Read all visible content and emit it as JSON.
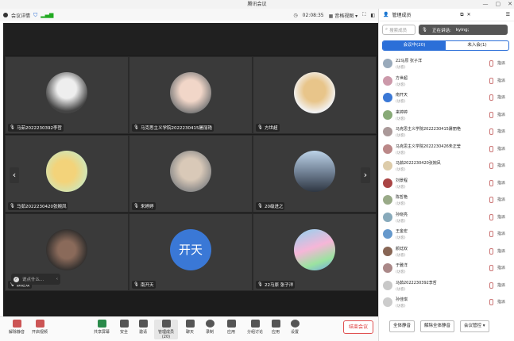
{
  "window": {
    "title": "腾讯会议"
  },
  "toolbar": {
    "info": "会议详情",
    "time": "02:08:35",
    "view": "音格视图"
  },
  "panel": {
    "title": "管理成员",
    "search_placeholder": "搜索成员",
    "speaking_label": "正在讲话:",
    "speaking_name": "kying;",
    "tab_in": "会议中(20)",
    "tab_out": "未入会(1)",
    "mute_all": "全体静音",
    "unmute_all": "解除全体静音",
    "control": "会议管控 ▾",
    "action": "指派",
    "role": "(访客)"
  },
  "tiles": [
    {
      "name": "马茹2022230392李哲"
    },
    {
      "name": "马克思主义学院2022230415屠丽艳"
    },
    {
      "name": "方世超"
    },
    {
      "name": "马茹2022230420张婉凤"
    },
    {
      "name": "来婷婷"
    },
    {
      "name": "20级进之"
    },
    {
      "name": "颜廷双"
    },
    {
      "name": "南开天",
      "avatar_text": "开天"
    },
    {
      "name": "22马原 张子洋"
    }
  ],
  "participants": [
    {
      "name": "22马原 张子洋",
      "color": "#9ab"
    },
    {
      "name": "方世超",
      "color": "#c9a"
    },
    {
      "name": "南开天",
      "color": "#3a78d6"
    },
    {
      "name": "来婷婷",
      "color": "#8a7"
    },
    {
      "name": "马克思主义学院2022230415屠丽艳",
      "color": "#a99"
    },
    {
      "name": "马克思主义学院2022230426朱正莹",
      "color": "#b88"
    },
    {
      "name": "马茹2022230420张婉凤",
      "color": "#dca"
    },
    {
      "name": "刘景程",
      "color": "#a44"
    },
    {
      "name": "陈哲艳",
      "color": "#9a8"
    },
    {
      "name": "孙晓亮",
      "color": "#8ab"
    },
    {
      "name": "王金宏",
      "color": "#69c"
    },
    {
      "name": "颜廷双",
      "color": "#865"
    },
    {
      "name": "于雅洋",
      "color": "#a88"
    },
    {
      "name": "马茹2022230392李哲",
      "color": "#c8c8c8"
    },
    {
      "name": "孙佳琪",
      "color": "#ccc"
    }
  ],
  "chat": {
    "placeholder": "说点什么..."
  },
  "bottom": {
    "mute": "解除静音",
    "video": "开启视频",
    "share": "共享屏幕",
    "security": "安全",
    "invite": "邀请",
    "members": "管理成员(20)",
    "chat": "聊天",
    "record": "录制",
    "apps": "应用",
    "breakout": "分组讨论",
    "app2": "应用",
    "settings": "设置",
    "end": "结束会议"
  }
}
